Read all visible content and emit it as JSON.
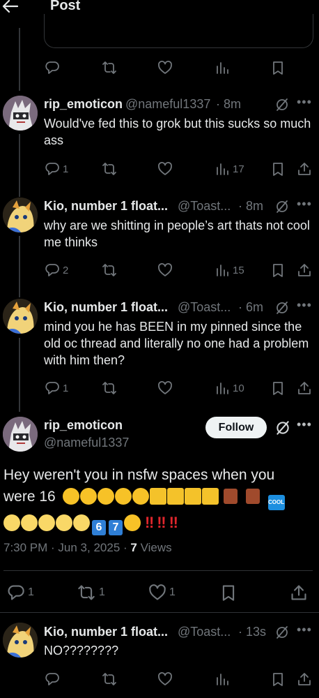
{
  "header": {
    "title": "Post",
    "back_icon": "arrow-left-icon"
  },
  "replies_above": [
    {
      "id": "r1",
      "name": "rip_emoticon",
      "handle": "@nameful1337",
      "time": "· 8m",
      "text": "Would've fed this to grok but this sucks so much ass",
      "replies": "1",
      "views": "17"
    },
    {
      "id": "r2",
      "name": "Kio, number 1 float...",
      "handle": "@Toast...",
      "time": "· 8m",
      "text": "why are we shitting in people’s art thats not cool me thinks",
      "replies": "2",
      "views": "15"
    },
    {
      "id": "r3",
      "name": "Kio, number 1 float...",
      "handle": "@Toast...",
      "time": "· 6m",
      "text": "mind you he has BEEN in my pinned since the old oc thread and literally no one had a problem with him then?",
      "replies": "1",
      "views": "10"
    }
  ],
  "main_post": {
    "name": "rip_emoticon",
    "handle": "@nameful1337",
    "follow_label": "Follow",
    "text_line1": "Hey weren't you in nsfw spaces when you",
    "text_line2_start": "were 16",
    "emoji_sequence": [
      "joy x5",
      "people-with-bunny-ears x4",
      "door x2",
      "cool-button",
      "yellow-circle x5",
      "keycap-6",
      "keycap-7",
      "pensive-face",
      "double-exclamation x3"
    ],
    "keycap_6": "6",
    "keycap_7": "7",
    "cool_badge": "COOL",
    "bangs": "‼",
    "timestamp": "7:30 PM · Jun 3, 2025 · ",
    "views_count": "7",
    "views_label": " Views",
    "replies": "1",
    "reposts": "1",
    "likes": "1"
  },
  "reply_below": {
    "name": "Kio, number 1 float...",
    "handle": "@Toast...",
    "time": "· 13s",
    "text": "NO????????"
  },
  "colors": {
    "background": "#000000",
    "text": "#e7e9ea",
    "muted": "#71767b",
    "divider": "#2f3336",
    "follow_bg": "#eff3f4"
  }
}
